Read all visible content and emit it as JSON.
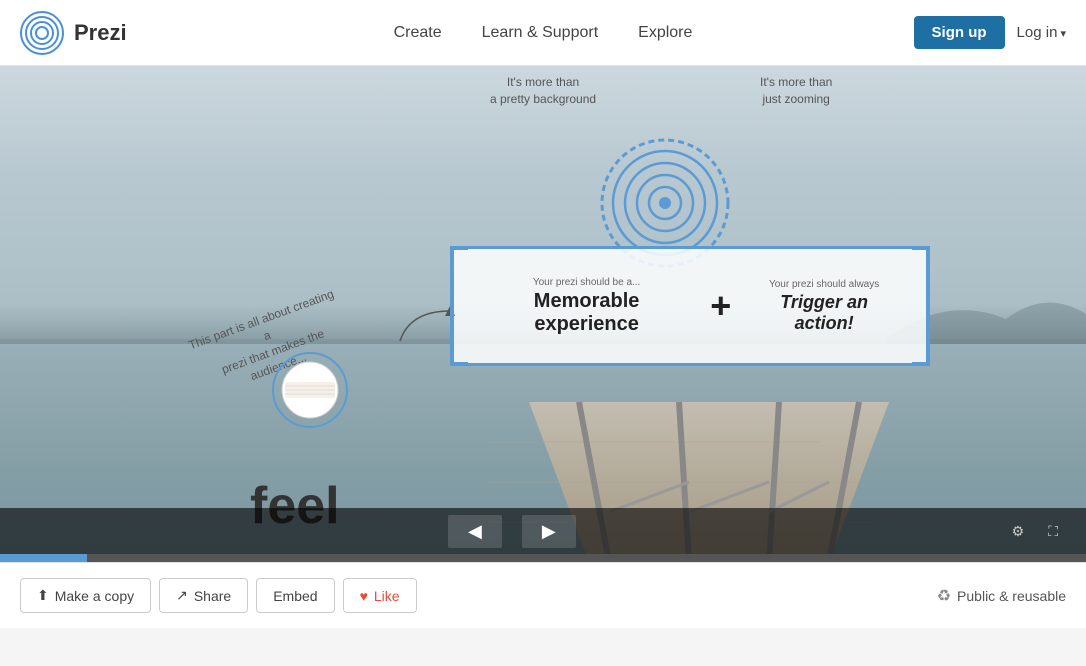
{
  "header": {
    "logo_text": "Prezi",
    "nav": {
      "create": "Create",
      "learn_support": "Learn & Support",
      "explore": "Explore"
    },
    "signup_label": "Sign up",
    "login_label": "Log in"
  },
  "presentation": {
    "overlay_top_left": "It's more than\na pretty background",
    "overlay_top_right": "It's more than\njust zooming",
    "bracket_box": {
      "left_label": "Your prezi should be a...",
      "left_big": "Memorable experience",
      "plus": "+",
      "right_label": "Your prezi should always",
      "right_big": "Trigger an action!"
    },
    "diagonal_text": "This part is all about creating a\nprezi that makes the audience...",
    "feel_text": "feel"
  },
  "bottom_toolbar": {
    "make_copy": "Make a copy",
    "share": "Share",
    "embed": "Embed",
    "like": "Like",
    "public_reusable": "Public & reusable"
  },
  "colors": {
    "blue": "#1d6fa4",
    "bracket_blue": "#5b9bd5"
  }
}
